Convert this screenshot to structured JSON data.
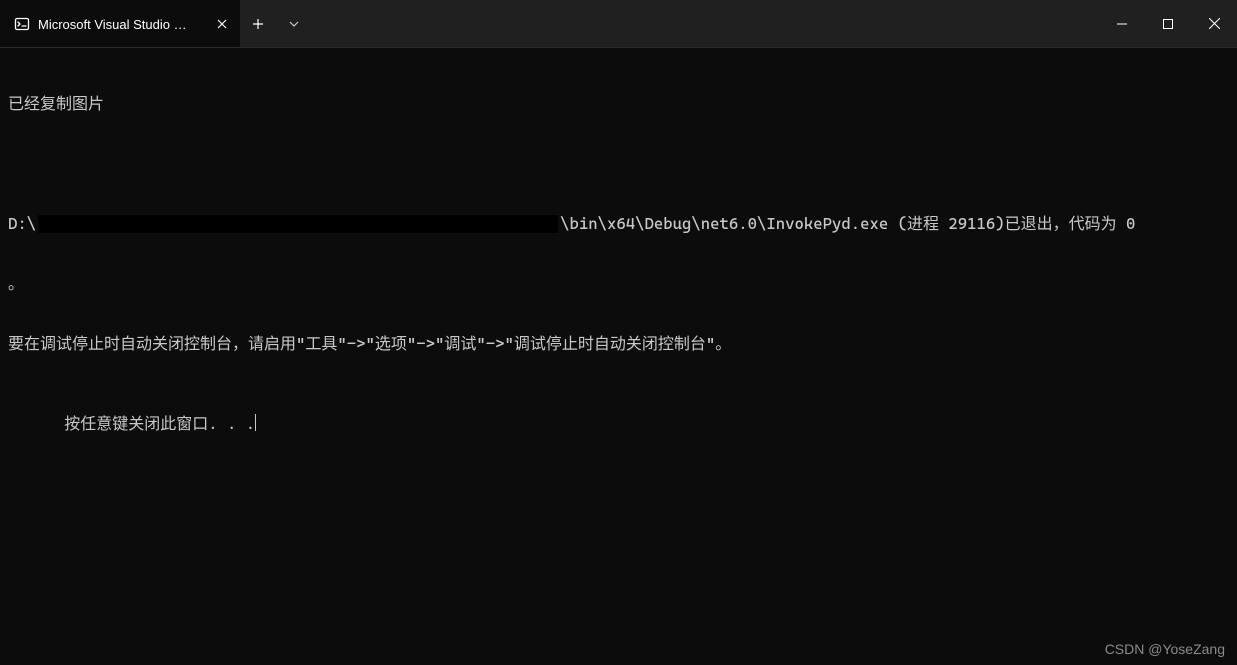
{
  "titlebar": {
    "tab_title": "Microsoft Visual Studio 调试控",
    "new_tab_label": "+",
    "dropdown_label": "▾"
  },
  "window_controls": {
    "minimize": "−",
    "maximize": "□",
    "close": "×"
  },
  "terminal": {
    "line1": "已经复制图片",
    "line2_prefix": "D:\\",
    "line2_suffix": "\\bin\\x64\\Debug\\net6.0\\InvokePyd.exe (进程 29116)已退出，代码为 0",
    "line3": "。",
    "line4": "要在调试停止时自动关闭控制台，请启用\"工具\"->\"选项\"->\"调试\"->\"调试停止时自动关闭控制台\"。",
    "line5": "按任意键关闭此窗口. . ."
  },
  "watermark": "CSDN @YoseZang"
}
